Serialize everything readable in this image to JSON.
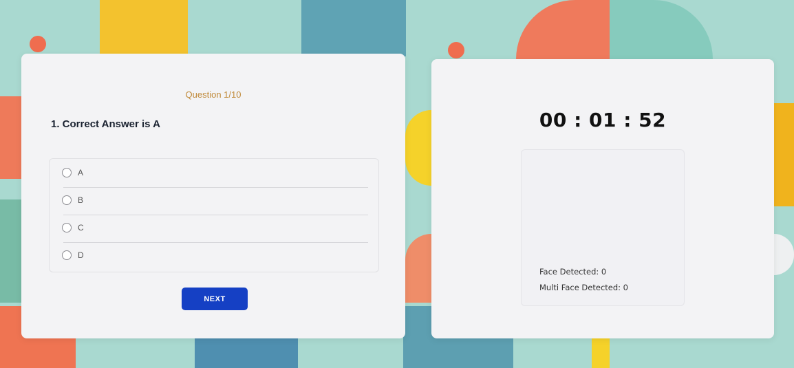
{
  "quiz": {
    "counter": "Question 1/10",
    "question": "1. Correct Answer is A",
    "options": [
      {
        "label": "A"
      },
      {
        "label": "B"
      },
      {
        "label": "C"
      },
      {
        "label": "D"
      }
    ],
    "next_label": "NEXT"
  },
  "proctor": {
    "timer": "00 : 01 : 52",
    "face_detected": "Face Detected: 0",
    "multi_face_detected": "Multi Face Detected: 0"
  },
  "colors": {
    "accent_button": "#1540c4",
    "counter_text": "#c08a3a"
  }
}
